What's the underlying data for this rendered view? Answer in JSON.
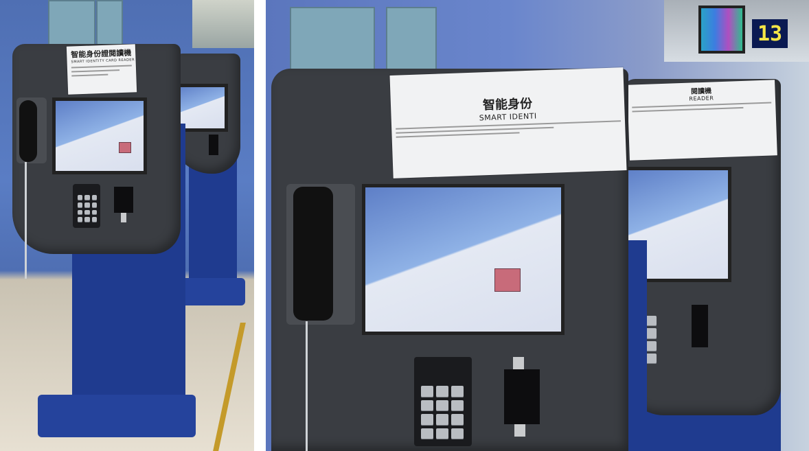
{
  "photos": [
    {
      "id_label": "left",
      "notice": {
        "title_zh": "智能身份證閱讀機",
        "title_en": "SMART IDENTITY CARD READER"
      }
    },
    {
      "id_label": "right",
      "notice": {
        "title_zh": "智能身份",
        "title_en": "SMART IDENTI"
      },
      "notice_second": {
        "title_zh": "閱讀機",
        "title_en": "READER"
      },
      "queue_number": "13"
    }
  ],
  "colors": {
    "kiosk_body": "#3a3d42",
    "stand_blue": "#1f3b8f",
    "wall_blue": "#5a7dc4",
    "queue_sign_text": "#f5e646"
  },
  "icons": [
    "keypad-icon",
    "handset-icon",
    "card-slot-icon"
  ]
}
